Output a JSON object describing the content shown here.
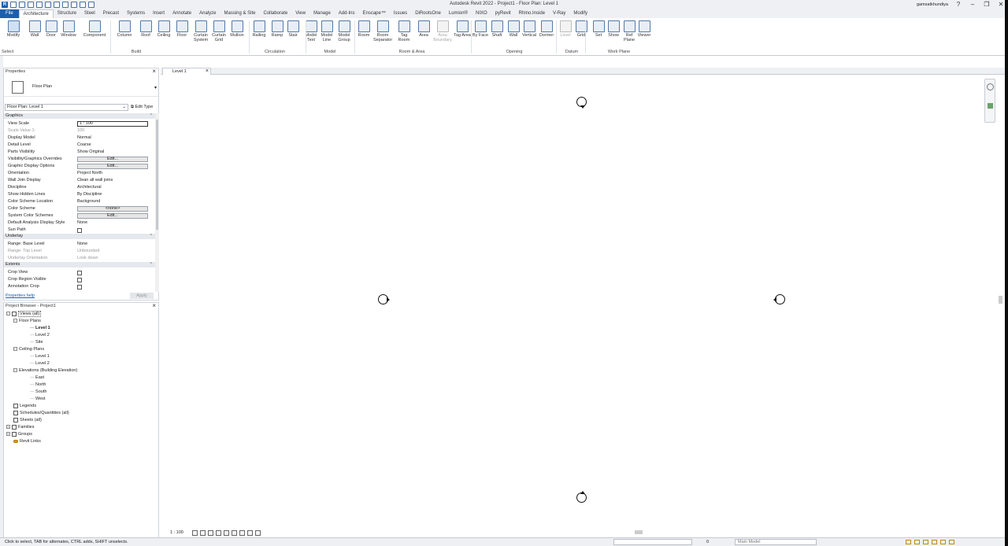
{
  "app": {
    "title": "Autodesk Revit 2022 - Project1 - Floor Plan: Level 1",
    "user": "gamsatkhundiya",
    "logo": "R"
  },
  "tabs": [
    "File",
    "Architecture",
    "Structure",
    "Steel",
    "Precast",
    "Systems",
    "Insert",
    "Annotate",
    "Analyze",
    "Massing & Site",
    "Collaborate",
    "View",
    "Manage",
    "Add-Ins",
    "Enscape™",
    "Issues",
    "DiRootsOne",
    "Lumion®",
    "NIXO",
    "pyRevit",
    "Rhino.Inside",
    "V-Ray",
    "Modify"
  ],
  "active_tab": "Architecture",
  "ribbon": {
    "buttons": [
      {
        "label": "Modify"
      },
      {
        "label": "Wall"
      },
      {
        "label": "Door"
      },
      {
        "label": "Window"
      },
      {
        "label": "Component"
      },
      {
        "label": "Column"
      },
      {
        "label": "Roof"
      },
      {
        "label": "Ceiling"
      },
      {
        "label": "Floor"
      },
      {
        "label": "Curtain System"
      },
      {
        "label": "Curtain Grid"
      },
      {
        "label": "Mullion"
      },
      {
        "label": "Railing"
      },
      {
        "label": "Ramp"
      },
      {
        "label": "Stair"
      },
      {
        "label": "Model Text"
      },
      {
        "label": "Model Line"
      },
      {
        "label": "Model Group"
      },
      {
        "label": "Room"
      },
      {
        "label": "Room Separator"
      },
      {
        "label": "Tag Room"
      },
      {
        "label": "Area"
      },
      {
        "label": "Area Boundary"
      },
      {
        "label": "Tag Area"
      },
      {
        "label": "By Face"
      },
      {
        "label": "Shaft"
      },
      {
        "label": "Wall"
      },
      {
        "label": "Vertical"
      },
      {
        "label": "Dormer"
      },
      {
        "label": "Level"
      },
      {
        "label": "Grid"
      },
      {
        "label": "Set"
      },
      {
        "label": "Show"
      },
      {
        "label": "Ref Plane"
      },
      {
        "label": "Viewer"
      }
    ],
    "panels": [
      "Select",
      "Build",
      "Circulation",
      "Model",
      "Room & Area",
      "Opening",
      "Datum",
      "Work Plane"
    ]
  },
  "properties": {
    "title": "Properties",
    "type_name": "Floor Plan",
    "instance": "Floor Plan: Level 1",
    "edit_type": "Edit Type",
    "groups": [
      {
        "name": "Graphics",
        "rows": [
          {
            "k": "View Scale",
            "v": "1 : 100",
            "kind": "input"
          },
          {
            "k": "Scale Value    1:",
            "v": "100",
            "kind": "ro"
          },
          {
            "k": "Display Model",
            "v": "Normal",
            "kind": "text"
          },
          {
            "k": "Detail Level",
            "v": "Coarse",
            "kind": "text"
          },
          {
            "k": "Parts Visibility",
            "v": "Show Original",
            "kind": "text"
          },
          {
            "k": "Visibility/Graphics Overrides",
            "v": "Edit...",
            "kind": "button"
          },
          {
            "k": "Graphic Display Options",
            "v": "Edit...",
            "kind": "button"
          },
          {
            "k": "Orientation",
            "v": "Project North",
            "kind": "text"
          },
          {
            "k": "Wall Join Display",
            "v": "Clean all wall joins",
            "kind": "text"
          },
          {
            "k": "Discipline",
            "v": "Architectural",
            "kind": "text"
          },
          {
            "k": "Show Hidden Lines",
            "v": "By Discipline",
            "kind": "text"
          },
          {
            "k": "Color Scheme Location",
            "v": "Background",
            "kind": "text"
          },
          {
            "k": "Color Scheme",
            "v": "<none>",
            "kind": "button"
          },
          {
            "k": "System Color Schemes",
            "v": "Edit...",
            "kind": "button"
          },
          {
            "k": "Default Analysis Display Style",
            "v": "None",
            "kind": "text"
          },
          {
            "k": "Sun Path",
            "v": "",
            "kind": "check"
          }
        ]
      },
      {
        "name": "Underlay",
        "rows": [
          {
            "k": "Range: Base Level",
            "v": "None",
            "kind": "text"
          },
          {
            "k": "Range: Top Level",
            "v": "Unbounded",
            "kind": "ro"
          },
          {
            "k": "Underlay Orientation",
            "v": "Look down",
            "kind": "ro"
          }
        ]
      },
      {
        "name": "Extents",
        "rows": [
          {
            "k": "Crop View",
            "v": "",
            "kind": "check"
          },
          {
            "k": "Crop Region Visible",
            "v": "",
            "kind": "check"
          },
          {
            "k": "Annotation Crop",
            "v": "",
            "kind": "check"
          }
        ]
      }
    ],
    "help": "Properties help",
    "apply": "Apply"
  },
  "browser": {
    "title": "Project Browser - Project1",
    "nodes": [
      {
        "label": "Views (all)",
        "depth": 0,
        "icon": "views-icon",
        "toggle": "-"
      },
      {
        "label": "Floor Plans",
        "depth": 1,
        "toggle": "-"
      },
      {
        "label": "Level 1",
        "depth": 2,
        "bold": true
      },
      {
        "label": "Level 2",
        "depth": 2
      },
      {
        "label": "Site",
        "depth": 2
      },
      {
        "label": "Ceiling Plans",
        "depth": 1,
        "toggle": "-"
      },
      {
        "label": "Level 1",
        "depth": 2
      },
      {
        "label": "Level 2",
        "depth": 2
      },
      {
        "label": "Elevations (Building Elevation)",
        "depth": 1,
        "toggle": "-"
      },
      {
        "label": "East",
        "depth": 2
      },
      {
        "label": "North",
        "depth": 2
      },
      {
        "label": "South",
        "depth": 2
      },
      {
        "label": "West",
        "depth": 2
      },
      {
        "label": "Legends",
        "depth": 0,
        "icon": "legends-icon"
      },
      {
        "label": "Schedules/Quantities (all)",
        "depth": 0,
        "icon": "schedules-icon"
      },
      {
        "label": "Sheets (all)",
        "depth": 0,
        "icon": "sheets-icon"
      },
      {
        "label": "Families",
        "depth": 0,
        "icon": "families-icon",
        "toggle": "+"
      },
      {
        "label": "Groups",
        "depth": 0,
        "icon": "groups-icon",
        "toggle": "+"
      },
      {
        "label": "Revit Links",
        "depth": 0,
        "icon": "links-icon"
      }
    ]
  },
  "view_tab": {
    "label": "Level 1"
  },
  "view_control": {
    "scale": "1 : 100"
  },
  "status": {
    "message": "Click to select, TAB for alternates, CTRL adds, SHIFT unselects.",
    "model": "Main Model",
    "filter_count": "0"
  }
}
